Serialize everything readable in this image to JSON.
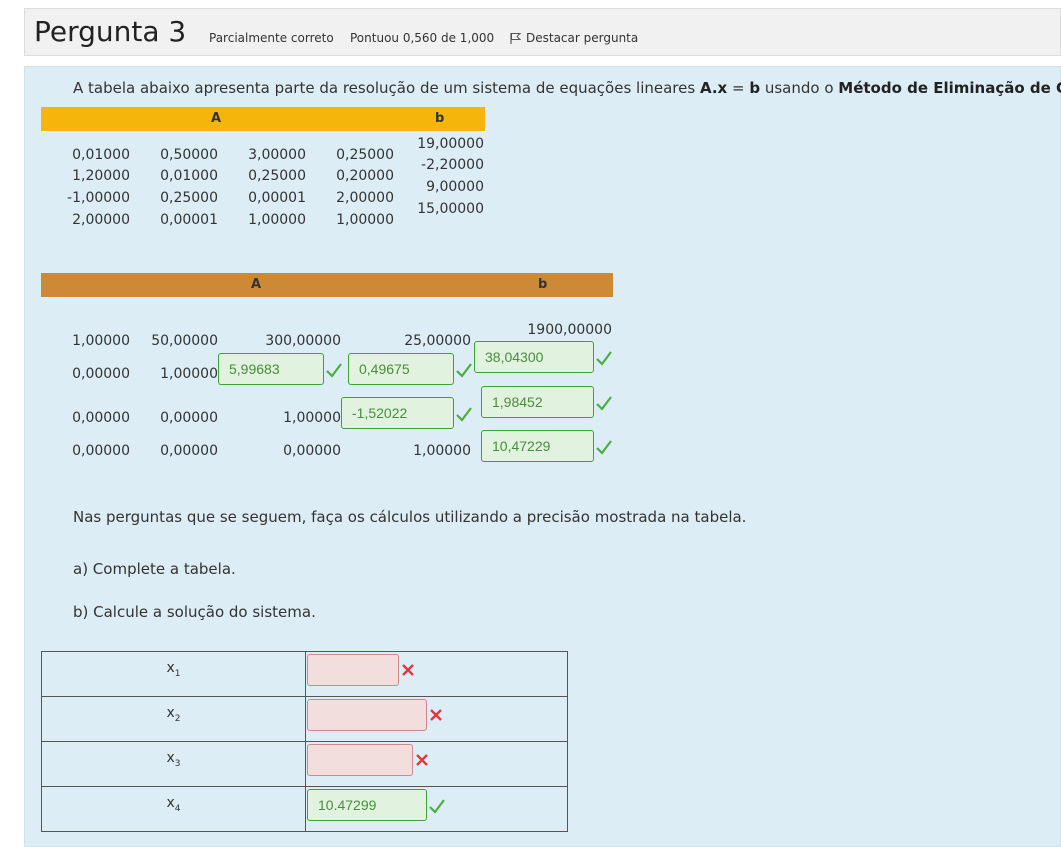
{
  "header": {
    "title": "Pergunta 3",
    "state": "Parcialmente correto",
    "grade": "Pontuou 0,560 de 1,000",
    "flag_label": "Destacar pergunta"
  },
  "intro": {
    "prefix": "A tabela abaixo apresenta parte da resolução de um sistema de equações lineares ",
    "eq": "A.x",
    "mid": " = ",
    "b": "b",
    "usando": " usando o ",
    "method": "Método de Eliminação de Gauss",
    "suffix": ":"
  },
  "table1": {
    "header_a": "A",
    "header_b": "b",
    "rows_a": [
      [
        "0,01000",
        "0,50000",
        "3,00000",
        "0,25000"
      ],
      [
        "1,20000",
        "0,01000",
        "0,25000",
        "0,20000"
      ],
      [
        "-1,00000",
        "0,25000",
        "0,00001",
        "2,00000"
      ],
      [
        "2,00000",
        "0,00001",
        "1,00000",
        "1,00000"
      ]
    ],
    "b": [
      "19,00000",
      "-2,20000",
      "9,00000",
      "15,00000"
    ]
  },
  "table2": {
    "header_a": "A",
    "header_b": "b",
    "row1": [
      "1,00000",
      "50,00000",
      "300,00000",
      "25,00000",
      "1900,00000"
    ],
    "row2": [
      "0,00000",
      "1,00000"
    ],
    "row3": [
      "0,00000",
      "0,00000",
      "1,00000"
    ],
    "row4": [
      "0,00000",
      "0,00000",
      "0,00000",
      "1,00000"
    ],
    "answers": {
      "r2c3": "5,99683",
      "r2c4": "0,49675",
      "r2b": "38,04300",
      "r3c4": "-1,52022",
      "r3b": "1,98452",
      "r4b": "10,47229"
    }
  },
  "instructions": "Nas perguntas que se seguem, faça os cálculos utilizando a precisão mostrada na tabela.",
  "part_a": "a) Complete a tabela.",
  "part_b": "b) Calcule a solução do sistema.",
  "solution": [
    {
      "var": "x",
      "sub": "1",
      "value": "",
      "status": "incorrect"
    },
    {
      "var": "x",
      "sub": "2",
      "value": "",
      "status": "incorrect"
    },
    {
      "var": "x",
      "sub": "3",
      "value": "",
      "status": "incorrect"
    },
    {
      "var": "x",
      "sub": "4",
      "value": "10.47299",
      "status": "correct"
    }
  ],
  "colors": {
    "correct": "#4cae3c",
    "incorrect": "#e0393e",
    "bar_a": "#f6b50b",
    "bar_b": "#cd8a36",
    "panel": "#dcedf6"
  }
}
